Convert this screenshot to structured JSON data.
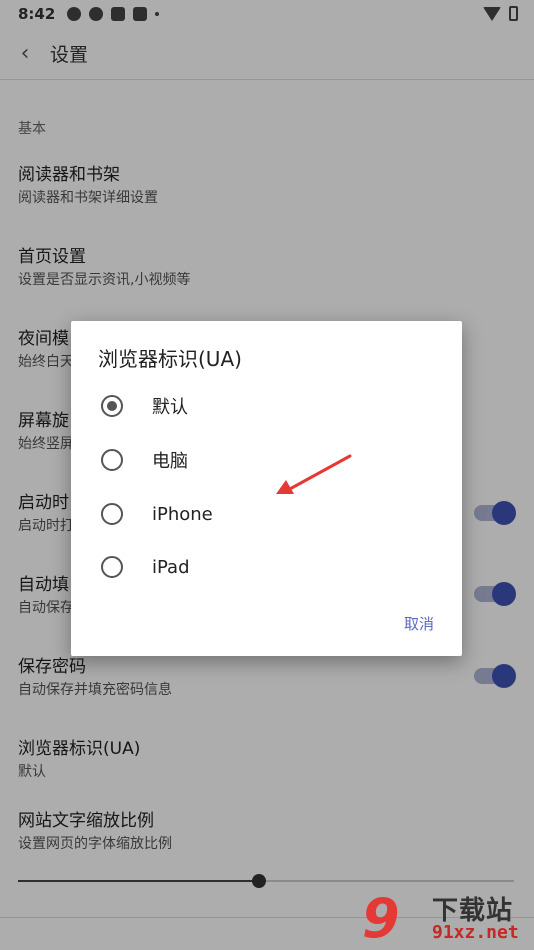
{
  "status": {
    "time": "8:42"
  },
  "app_bar": {
    "title": "设置"
  },
  "section": {
    "basic": "基本"
  },
  "settings": [
    {
      "title": "阅读器和书架",
      "sub": "阅读器和书架详细设置"
    },
    {
      "title": "首页设置",
      "sub": "设置是否显示资讯,小视频等"
    },
    {
      "title": "夜间模",
      "sub": "始终白天"
    },
    {
      "title": "屏幕旋",
      "sub": "始终竖屏"
    },
    {
      "title": "启动时",
      "sub": "启动时打"
    },
    {
      "title": "自动填",
      "sub": "自动保存"
    },
    {
      "title": "保存密码",
      "sub": "自动保存并填充密码信息"
    },
    {
      "title": "浏览器标识(UA)",
      "sub": "默认"
    },
    {
      "title": "网站文字缩放比例",
      "sub": "设置网页的字体缩放比例"
    }
  ],
  "toggles": {
    "startup": true,
    "autofill": true,
    "save_password": true
  },
  "font_scale_slider": {
    "value": 0.485
  },
  "dialog": {
    "title": "浏览器标识(UA)",
    "options": [
      {
        "label": "默认",
        "selected": true
      },
      {
        "label": "电脑",
        "selected": false
      },
      {
        "label": "iPhone",
        "selected": false
      },
      {
        "label": "iPad",
        "selected": false
      }
    ],
    "cancel": "取消"
  },
  "watermark": {
    "brand": "下载站",
    "url": "91xz.net",
    "number": "9"
  },
  "colors": {
    "accent": "#3f51b5",
    "link": "#5c6bc0",
    "annotation_arrow": "#e53935"
  }
}
